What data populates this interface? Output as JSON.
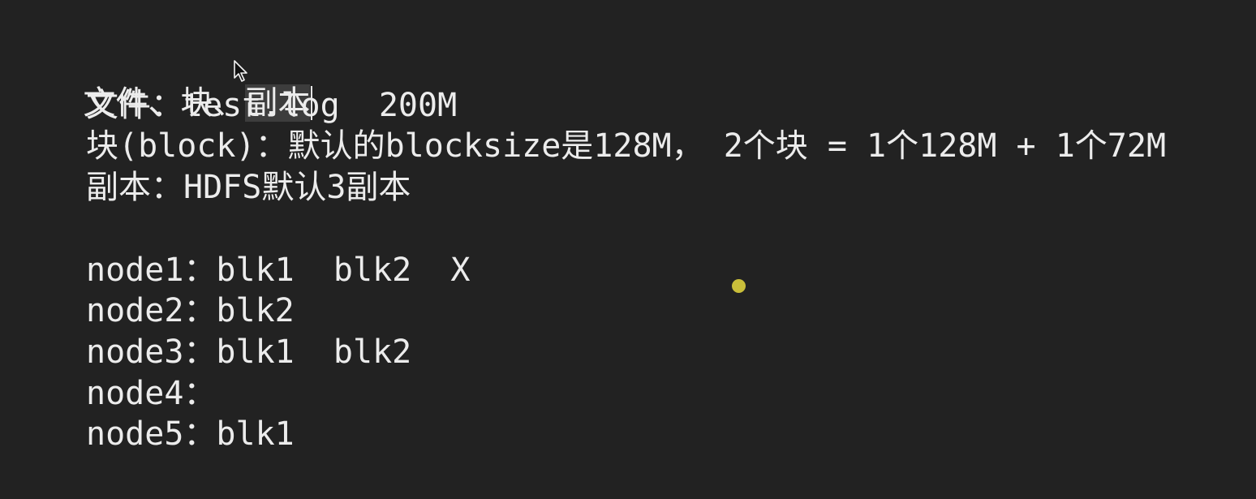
{
  "editor": {
    "heading": {
      "part1": "文件、块、",
      "part2": "副本"
    },
    "lines": [
      "文件：test.log  200M",
      "块(block)：默认的blocksize是128M， 2个块 = 1个128M + 1个72M",
      "副本：HDFS默认3副本"
    ],
    "nodes": [
      "node1：blk1  blk2  X",
      "node2：blk2",
      "node3：blk1  blk2",
      "node4：",
      "node5：blk1"
    ]
  },
  "colors": {
    "background": "#222222",
    "text": "#ececec",
    "selection": "#3d3d3d",
    "pointer_dot": "#c9be3a"
  },
  "icons": [
    "text-cursor-icon",
    "mouse-pointer-icon",
    "pointer-dot-icon"
  ]
}
